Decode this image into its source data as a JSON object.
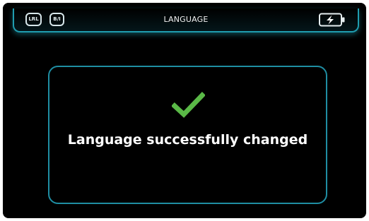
{
  "header": {
    "title": "LANGUAGE",
    "status_left": [
      "LRL",
      "B/I"
    ],
    "battery_icon": "battery-charging-icon"
  },
  "dialog": {
    "icon": "checkmark-icon",
    "message": "Language successfully changed"
  },
  "colors": {
    "background": "#000000",
    "accent": "#1f9db0",
    "success": "#5ab947",
    "text": "#ffffff"
  }
}
